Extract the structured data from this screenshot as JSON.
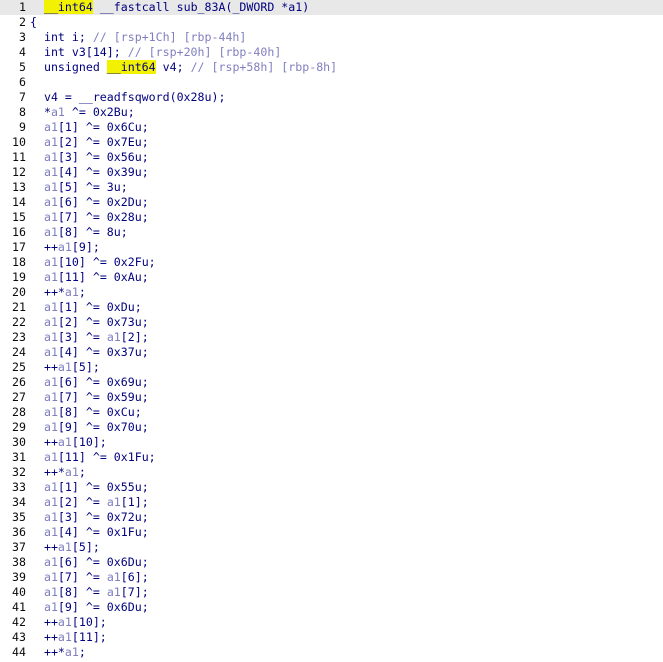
{
  "editor": {
    "lines": [
      {
        "n": "1",
        "parts": [
          {
            "t": "  ",
            "c": "txt"
          },
          {
            "t": "__int64",
            "c": "hl"
          },
          {
            "t": " __fastcall sub_83A(_DWORD *a1)",
            "c": "txt"
          }
        ]
      },
      {
        "n": "2",
        "parts": [
          {
            "t": "{",
            "c": "txt"
          }
        ]
      },
      {
        "n": "3",
        "parts": [
          {
            "t": "  int i; ",
            "c": "txt"
          },
          {
            "t": "// [rsp+1Ch] [rbp-44h]",
            "c": "cm"
          }
        ]
      },
      {
        "n": "4",
        "parts": [
          {
            "t": "  int v3[14]; ",
            "c": "txt"
          },
          {
            "t": "// [rsp+20h] [rbp-40h]",
            "c": "cm"
          }
        ]
      },
      {
        "n": "5",
        "parts": [
          {
            "t": "  unsigned ",
            "c": "txt"
          },
          {
            "t": "__int64",
            "c": "hl"
          },
          {
            "t": " v4; ",
            "c": "txt"
          },
          {
            "t": "// [rsp+58h] [rbp-8h]",
            "c": "cm"
          }
        ]
      },
      {
        "n": "6",
        "parts": [
          {
            "t": "",
            "c": "txt"
          }
        ]
      },
      {
        "n": "7",
        "parts": [
          {
            "t": "  v4 = __readfsqword(0x28u);",
            "c": "txt"
          }
        ]
      },
      {
        "n": "8",
        "parts": [
          {
            "t": "  *",
            "c": "txt"
          },
          {
            "t": "a1",
            "c": "var"
          },
          {
            "t": " ^= 0x2Bu;",
            "c": "txt"
          }
        ]
      },
      {
        "n": "9",
        "parts": [
          {
            "t": "  ",
            "c": "txt"
          },
          {
            "t": "a1",
            "c": "var"
          },
          {
            "t": "[1] ^= 0x6Cu;",
            "c": "txt"
          }
        ]
      },
      {
        "n": "10",
        "parts": [
          {
            "t": "  ",
            "c": "txt"
          },
          {
            "t": "a1",
            "c": "var"
          },
          {
            "t": "[2] ^= 0x7Eu;",
            "c": "txt"
          }
        ]
      },
      {
        "n": "11",
        "parts": [
          {
            "t": "  ",
            "c": "txt"
          },
          {
            "t": "a1",
            "c": "var"
          },
          {
            "t": "[3] ^= 0x56u;",
            "c": "txt"
          }
        ]
      },
      {
        "n": "12",
        "parts": [
          {
            "t": "  ",
            "c": "txt"
          },
          {
            "t": "a1",
            "c": "var"
          },
          {
            "t": "[4] ^= 0x39u;",
            "c": "txt"
          }
        ]
      },
      {
        "n": "13",
        "parts": [
          {
            "t": "  ",
            "c": "txt"
          },
          {
            "t": "a1",
            "c": "var"
          },
          {
            "t": "[5] ^= 3u;",
            "c": "txt"
          }
        ]
      },
      {
        "n": "14",
        "parts": [
          {
            "t": "  ",
            "c": "txt"
          },
          {
            "t": "a1",
            "c": "var"
          },
          {
            "t": "[6] ^= 0x2Du;",
            "c": "txt"
          }
        ]
      },
      {
        "n": "15",
        "parts": [
          {
            "t": "  ",
            "c": "txt"
          },
          {
            "t": "a1",
            "c": "var"
          },
          {
            "t": "[7] ^= 0x28u;",
            "c": "txt"
          }
        ]
      },
      {
        "n": "16",
        "parts": [
          {
            "t": "  ",
            "c": "txt"
          },
          {
            "t": "a1",
            "c": "var"
          },
          {
            "t": "[8] ^= 8u;",
            "c": "txt"
          }
        ]
      },
      {
        "n": "17",
        "parts": [
          {
            "t": "  ++",
            "c": "txt"
          },
          {
            "t": "a1",
            "c": "var"
          },
          {
            "t": "[9];",
            "c": "txt"
          }
        ]
      },
      {
        "n": "18",
        "parts": [
          {
            "t": "  ",
            "c": "txt"
          },
          {
            "t": "a1",
            "c": "var"
          },
          {
            "t": "[10] ^= 0x2Fu;",
            "c": "txt"
          }
        ]
      },
      {
        "n": "19",
        "parts": [
          {
            "t": "  ",
            "c": "txt"
          },
          {
            "t": "a1",
            "c": "var"
          },
          {
            "t": "[11] ^= 0xAu;",
            "c": "txt"
          }
        ]
      },
      {
        "n": "20",
        "parts": [
          {
            "t": "  ++*",
            "c": "txt"
          },
          {
            "t": "a1",
            "c": "var"
          },
          {
            "t": ";",
            "c": "txt"
          }
        ]
      },
      {
        "n": "21",
        "parts": [
          {
            "t": "  ",
            "c": "txt"
          },
          {
            "t": "a1",
            "c": "var"
          },
          {
            "t": "[1] ^= 0xDu;",
            "c": "txt"
          }
        ]
      },
      {
        "n": "22",
        "parts": [
          {
            "t": "  ",
            "c": "txt"
          },
          {
            "t": "a1",
            "c": "var"
          },
          {
            "t": "[2] ^= 0x73u;",
            "c": "txt"
          }
        ]
      },
      {
        "n": "23",
        "parts": [
          {
            "t": "  ",
            "c": "txt"
          },
          {
            "t": "a1",
            "c": "var"
          },
          {
            "t": "[3] ^= ",
            "c": "txt"
          },
          {
            "t": "a1",
            "c": "var"
          },
          {
            "t": "[2];",
            "c": "txt"
          }
        ]
      },
      {
        "n": "24",
        "parts": [
          {
            "t": "  ",
            "c": "txt"
          },
          {
            "t": "a1",
            "c": "var"
          },
          {
            "t": "[4] ^= 0x37u;",
            "c": "txt"
          }
        ]
      },
      {
        "n": "25",
        "parts": [
          {
            "t": "  ++",
            "c": "txt"
          },
          {
            "t": "a1",
            "c": "var"
          },
          {
            "t": "[5];",
            "c": "txt"
          }
        ]
      },
      {
        "n": "26",
        "parts": [
          {
            "t": "  ",
            "c": "txt"
          },
          {
            "t": "a1",
            "c": "var"
          },
          {
            "t": "[6] ^= 0x69u;",
            "c": "txt"
          }
        ]
      },
      {
        "n": "27",
        "parts": [
          {
            "t": "  ",
            "c": "txt"
          },
          {
            "t": "a1",
            "c": "var"
          },
          {
            "t": "[7] ^= 0x59u;",
            "c": "txt"
          }
        ]
      },
      {
        "n": "28",
        "parts": [
          {
            "t": "  ",
            "c": "txt"
          },
          {
            "t": "a1",
            "c": "var"
          },
          {
            "t": "[8] ^= 0xCu;",
            "c": "txt"
          }
        ]
      },
      {
        "n": "29",
        "parts": [
          {
            "t": "  ",
            "c": "txt"
          },
          {
            "t": "a1",
            "c": "var"
          },
          {
            "t": "[9] ^= 0x70u;",
            "c": "txt"
          }
        ]
      },
      {
        "n": "30",
        "parts": [
          {
            "t": "  ++",
            "c": "txt"
          },
          {
            "t": "a1",
            "c": "var"
          },
          {
            "t": "[10];",
            "c": "txt"
          }
        ]
      },
      {
        "n": "31",
        "parts": [
          {
            "t": "  ",
            "c": "txt"
          },
          {
            "t": "a1",
            "c": "var"
          },
          {
            "t": "[11] ^= 0x1Fu;",
            "c": "txt"
          }
        ]
      },
      {
        "n": "32",
        "parts": [
          {
            "t": "  ++*",
            "c": "txt"
          },
          {
            "t": "a1",
            "c": "var"
          },
          {
            "t": ";",
            "c": "txt"
          }
        ]
      },
      {
        "n": "33",
        "parts": [
          {
            "t": "  ",
            "c": "txt"
          },
          {
            "t": "a1",
            "c": "var"
          },
          {
            "t": "[1] ^= 0x55u;",
            "c": "txt"
          }
        ]
      },
      {
        "n": "34",
        "parts": [
          {
            "t": "  ",
            "c": "txt"
          },
          {
            "t": "a1",
            "c": "var"
          },
          {
            "t": "[2] ^= ",
            "c": "txt"
          },
          {
            "t": "a1",
            "c": "var"
          },
          {
            "t": "[1];",
            "c": "txt"
          }
        ]
      },
      {
        "n": "35",
        "parts": [
          {
            "t": "  ",
            "c": "txt"
          },
          {
            "t": "a1",
            "c": "var"
          },
          {
            "t": "[3] ^= 0x72u;",
            "c": "txt"
          }
        ]
      },
      {
        "n": "36",
        "parts": [
          {
            "t": "  ",
            "c": "txt"
          },
          {
            "t": "a1",
            "c": "var"
          },
          {
            "t": "[4] ^= 0x1Fu;",
            "c": "txt"
          }
        ]
      },
      {
        "n": "37",
        "parts": [
          {
            "t": "  ++",
            "c": "txt"
          },
          {
            "t": "a1",
            "c": "var"
          },
          {
            "t": "[5];",
            "c": "txt"
          }
        ]
      },
      {
        "n": "38",
        "parts": [
          {
            "t": "  ",
            "c": "txt"
          },
          {
            "t": "a1",
            "c": "var"
          },
          {
            "t": "[6] ^= 0x6Du;",
            "c": "txt"
          }
        ]
      },
      {
        "n": "39",
        "parts": [
          {
            "t": "  ",
            "c": "txt"
          },
          {
            "t": "a1",
            "c": "var"
          },
          {
            "t": "[7] ^= ",
            "c": "txt"
          },
          {
            "t": "a1",
            "c": "var"
          },
          {
            "t": "[6];",
            "c": "txt"
          }
        ]
      },
      {
        "n": "40",
        "parts": [
          {
            "t": "  ",
            "c": "txt"
          },
          {
            "t": "a1",
            "c": "var"
          },
          {
            "t": "[8] ^= ",
            "c": "txt"
          },
          {
            "t": "a1",
            "c": "var"
          },
          {
            "t": "[7];",
            "c": "txt"
          }
        ]
      },
      {
        "n": "41",
        "parts": [
          {
            "t": "  ",
            "c": "txt"
          },
          {
            "t": "a1",
            "c": "var"
          },
          {
            "t": "[9] ^= 0x6Du;",
            "c": "txt"
          }
        ]
      },
      {
        "n": "42",
        "parts": [
          {
            "t": "  ++",
            "c": "txt"
          },
          {
            "t": "a1",
            "c": "var"
          },
          {
            "t": "[10];",
            "c": "txt"
          }
        ]
      },
      {
        "n": "43",
        "parts": [
          {
            "t": "  ++",
            "c": "txt"
          },
          {
            "t": "a1",
            "c": "var"
          },
          {
            "t": "[11];",
            "c": "txt"
          }
        ]
      },
      {
        "n": "44",
        "parts": [
          {
            "t": "  ++*",
            "c": "txt"
          },
          {
            "t": "a1",
            "c": "var"
          },
          {
            "t": ";",
            "c": "txt"
          }
        ]
      }
    ]
  }
}
